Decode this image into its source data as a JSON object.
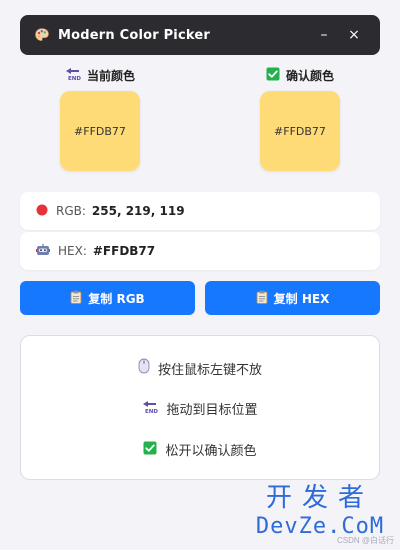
{
  "window": {
    "title": "Modern Color Picker",
    "minimize_label": "–",
    "close_label": "×"
  },
  "current_color": {
    "label": "当前颜色",
    "hex": "#FFDB77",
    "color": "#FFDB77"
  },
  "confirmed_color": {
    "label": "确认颜色",
    "hex": "#FFDB77",
    "color": "#FFDB77"
  },
  "rgb_row": {
    "label": "RGB:",
    "value": "255, 219, 119"
  },
  "hex_row": {
    "label": "HEX:",
    "value": "#FFDB77"
  },
  "buttons": {
    "copy_rgb": "复制 RGB",
    "copy_hex": "复制 HEX"
  },
  "instructions": [
    "按住鼠标左键不放",
    "拖动到目标位置",
    "松开以确认颜色"
  ],
  "watermark": {
    "line1": "开发者",
    "line2": "DevZe.CoM",
    "line3": "CSDN @白话行"
  },
  "colors": {
    "accent": "#1677ff",
    "titlebar": "#2b2b30",
    "swatch": "#FFDB77"
  },
  "icons": {
    "app": "palette-icon",
    "current": "end-arrow-icon",
    "confirmed": "check-box-icon",
    "rgb": "red-circle-icon",
    "hex": "robot-icon",
    "copy": "clipboard-icon",
    "step1": "mouse-icon",
    "step2": "end-arrow-icon",
    "step3": "check-box-icon"
  }
}
